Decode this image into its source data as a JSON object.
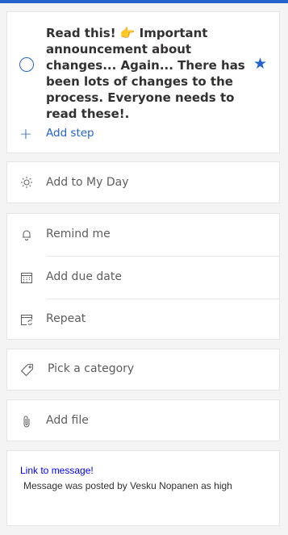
{
  "task": {
    "title": "Read this! 👉 Important announcement about changes... Again... There has been lots of changes to the process. Everyone needs to read these!.",
    "add_step_label": "Add step"
  },
  "my_day": {
    "label": "Add to My Day"
  },
  "dates": {
    "remind_label": "Remind me",
    "due_label": "Add due date",
    "repeat_label": "Repeat"
  },
  "category": {
    "label": "Pick a category"
  },
  "file": {
    "label": "Add file"
  },
  "note": {
    "link_text": "Link to message!",
    "body_text": "Message was posted by Vesku Nopanen as high"
  },
  "colors": {
    "accent": "#2564cf",
    "link": "#0000ee",
    "text_secondary": "#605e5c"
  }
}
